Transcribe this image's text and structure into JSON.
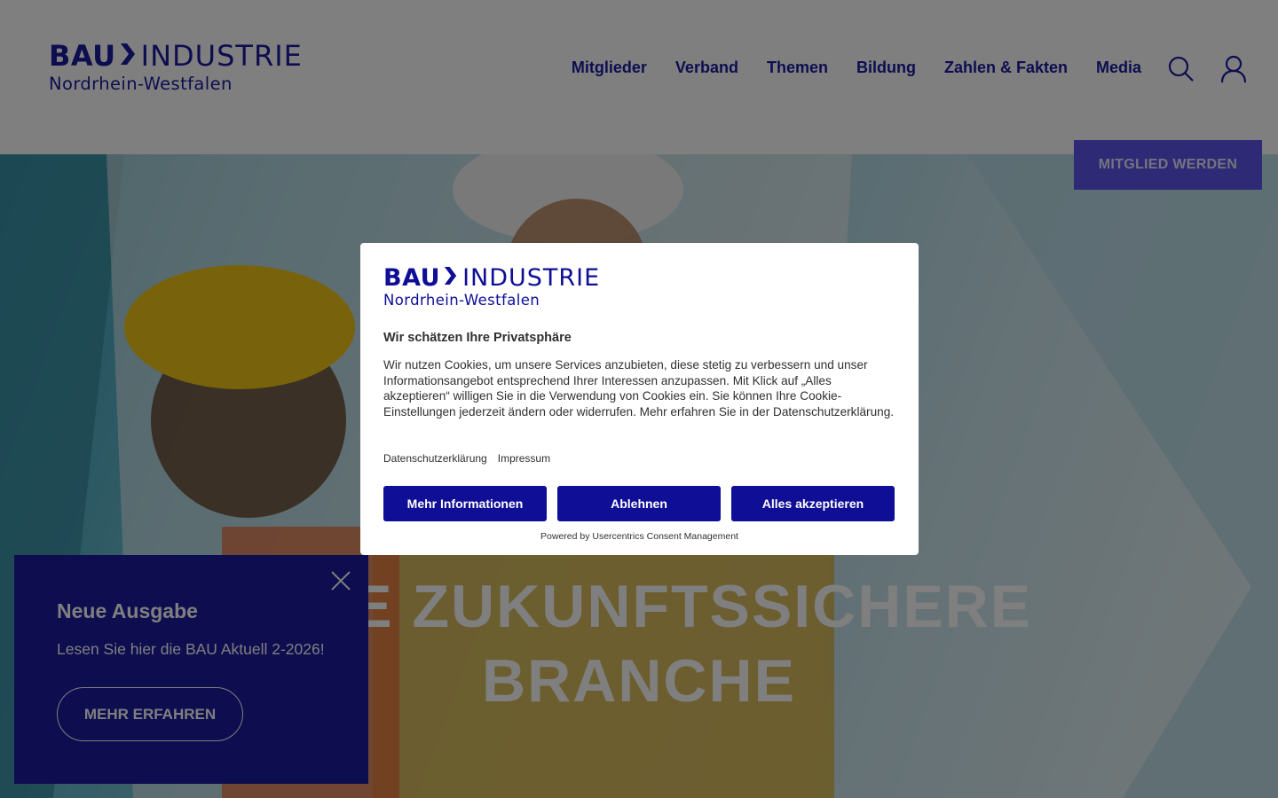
{
  "header": {
    "logo": {
      "bau": "BAU",
      "industrie": "INDUSTRIE",
      "region": "Nordrhein-Westfalen"
    },
    "nav": [
      "Mitglieder",
      "Verband",
      "Themen",
      "Bildung",
      "Zahlen & Fakten",
      "Media"
    ],
    "search_icon": "search-icon",
    "user_icon": "user-icon"
  },
  "hero": {
    "member_button": "MITGLIED WERDEN",
    "title_line1": "EINE ZUKUNFTSSICHERE",
    "title_line2": "BRANCHE"
  },
  "news": {
    "title": "Neue Ausgabe",
    "text": "Lesen Sie hier die BAU Aktuell 2-2026!",
    "button": "MEHR ERFAHREN",
    "close_icon": "close-icon"
  },
  "consent": {
    "logo": {
      "bau": "BAU",
      "industrie": "INDUSTRIE",
      "region": "Nordrhein-Westfalen"
    },
    "title": "Wir schätzen Ihre Privatsphäre",
    "text": "Wir nutzen Cookies, um unsere Services anzubieten, diese stetig zu verbessern und unser Informationsangebot entsprechend Ihrer Interessen anzupassen. Mit Klick auf „Alles akzeptieren“ willigen Sie in die Verwendung von Cookies ein. Sie können Ihre Cookie-Einstellungen jederzeit ändern oder widerrufen. Mehr erfahren Sie in der Datenschutzerklärung.",
    "links": [
      "Datenschutzerklärung",
      "Impressum"
    ],
    "buttons": [
      "Mehr Informationen",
      "Ablehnen",
      "Alles akzeptieren"
    ],
    "powered": "Powered by Usercentrics Consent Management"
  },
  "colors": {
    "brand": "#1a1aa0",
    "consent_button": "#0e0e96",
    "member_button": "#5d55ec",
    "overlay": "rgba(0,0,0,0.5)"
  }
}
